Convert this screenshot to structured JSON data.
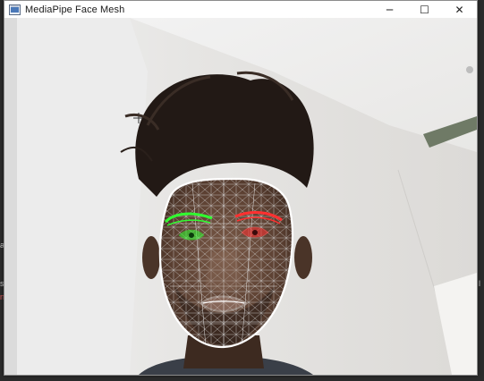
{
  "window": {
    "title": "MediaPipe Face Mesh",
    "controls": {
      "minimize": "─",
      "maximize": "☐",
      "close": "✕"
    }
  },
  "background_fragments": {
    "a": "a",
    "s": "s",
    "n": "n",
    "l": "l"
  },
  "camera_view": {
    "description_icon": "camera-frame",
    "overlay": {
      "mesh_color": "#d8d8d8",
      "outline_color": "#ffffff",
      "left_eye_color": "#30ff30",
      "right_eye_color": "#ff3030",
      "lips_color": "#ffffff"
    }
  }
}
